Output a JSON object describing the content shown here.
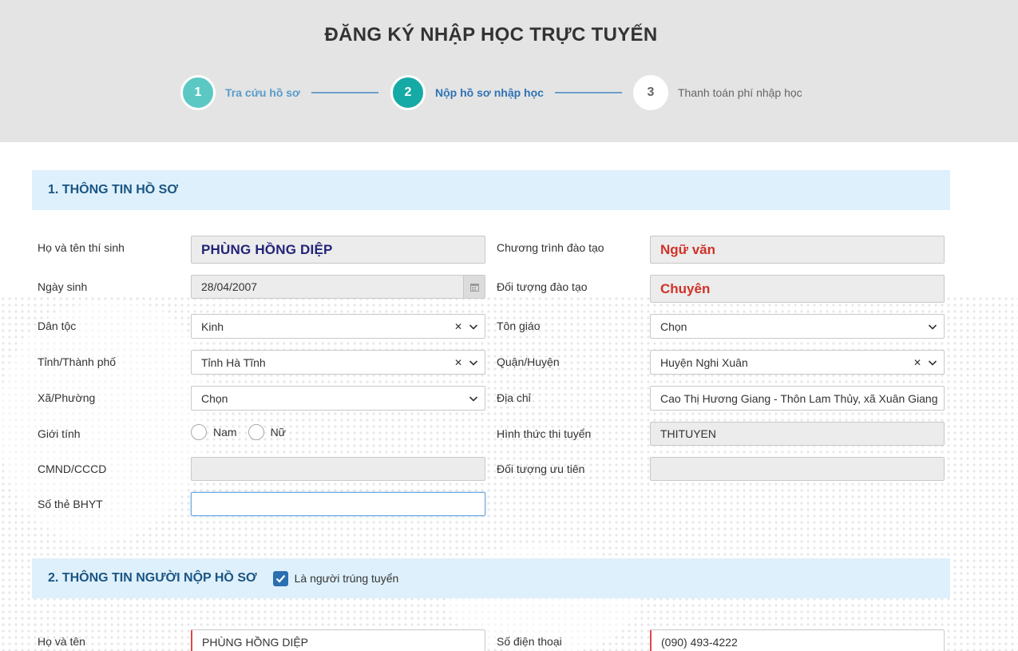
{
  "header": {
    "title": "ĐĂNG KÝ NHẬP HỌC TRỰC TUYẾN",
    "steps": [
      {
        "number": "1",
        "label": "Tra cứu hồ sơ"
      },
      {
        "number": "2",
        "label": "Nộp hồ sơ nhập học"
      },
      {
        "number": "3",
        "label": "Thanh toán phí nhập học"
      }
    ]
  },
  "section1": {
    "title": "1. THÔNG TIN HỒ SƠ",
    "ho_ten": {
      "label": "Họ và tên thí sinh",
      "value": "PHÙNG HỒNG DIỆP"
    },
    "chuong_trinh": {
      "label": "Chương trình đào tạo",
      "value": "Ngữ văn"
    },
    "ngay_sinh": {
      "label": "Ngày sinh",
      "value": "28/04/2007"
    },
    "doi_tuong_dt": {
      "label": "Đối tượng đào tạo",
      "value": "Chuyên"
    },
    "dan_toc": {
      "label": "Dân tộc",
      "value": "Kinh"
    },
    "ton_giao": {
      "label": "Tôn giáo",
      "value": "Chọn"
    },
    "tinh": {
      "label": "Tỉnh/Thành phố",
      "value": "Tỉnh Hà Tĩnh"
    },
    "quan": {
      "label": "Quận/Huyện",
      "value": "Huyện Nghi Xuân"
    },
    "xa": {
      "label": "Xã/Phường",
      "value": "Chọn"
    },
    "dia_chi": {
      "label": "Địa chỉ",
      "value": "Cao Thị Hương Giang - Thôn Lam Thủy, xã Xuân Giang"
    },
    "gioi_tinh": {
      "label": "Giới tính",
      "options": [
        "Nam",
        "Nữ"
      ]
    },
    "hinh_thuc": {
      "label": "Hình thức thi tuyển",
      "value": "THITUYEN"
    },
    "cmnd": {
      "label": "CMND/CCCD",
      "value": ""
    },
    "uu_tien": {
      "label": "Đối tượng ưu tiên",
      "value": ""
    },
    "bhyt": {
      "label": "Số thẻ BHYT",
      "value": ""
    }
  },
  "section2": {
    "title": "2. THÔNG TIN NGƯỜI NỘP HỒ SƠ",
    "checkbox_label": "Là người trúng tuyển",
    "checked": true,
    "ho_ten": {
      "label": "Họ và tên",
      "value": "PHÙNG HỒNG DIỆP"
    },
    "dien_thoai": {
      "label": "Số điện thoại",
      "value": "(090) 493-4222"
    }
  },
  "icons": [
    "close-icon",
    "chevron-down-icon",
    "calendar-icon",
    "check-icon"
  ],
  "colors": {
    "accent": "#16aaa6",
    "section_bg": "#def0fb",
    "section_title": "#1a5584",
    "required": "#e0474c",
    "highlight_red": "#d03228",
    "highlight_blue": "#23237a"
  }
}
